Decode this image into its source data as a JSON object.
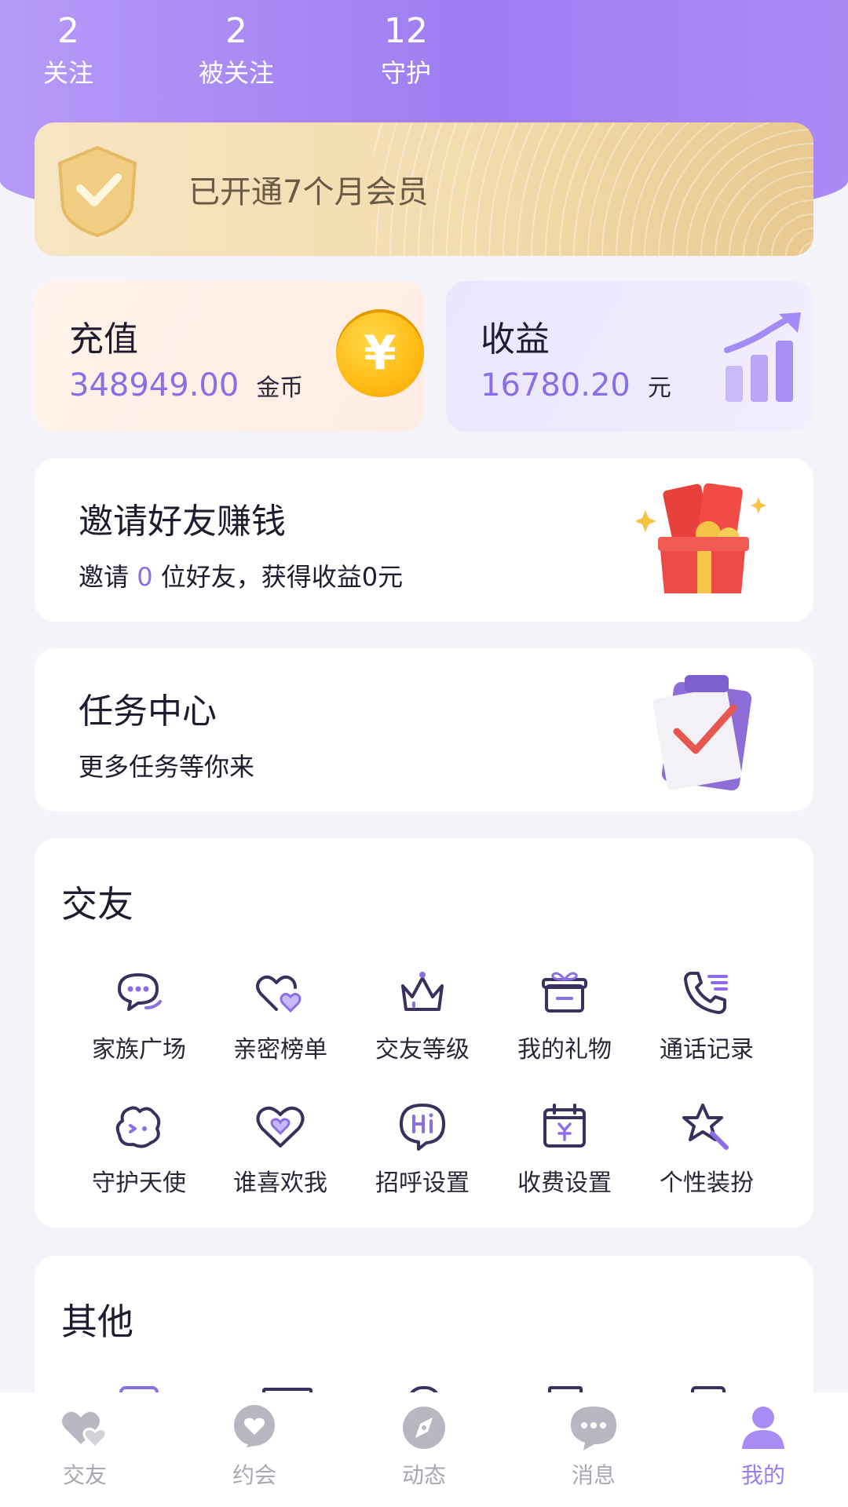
{
  "stats": [
    {
      "value": "2",
      "label": "关注"
    },
    {
      "value": "2",
      "label": "被关注"
    },
    {
      "value": "12",
      "label": "守护"
    }
  ],
  "vip": {
    "text": "已开通7个月会员"
  },
  "recharge": {
    "title": "充值",
    "value": "348949.00",
    "unit": "金币",
    "coin_symbol": "¥"
  },
  "income": {
    "title": "收益",
    "value": "16780.20",
    "unit": "元"
  },
  "invite": {
    "title": "邀请好友赚钱",
    "sub_prefix": "邀请",
    "count": "0",
    "sub_suffix": "位好友，获得收益0元"
  },
  "tasks": {
    "title": "任务中心",
    "subtitle": "更多任务等你来"
  },
  "friends_section": {
    "title": "交友",
    "items": [
      {
        "label": "家族广场",
        "icon": "chat-bubbles-icon"
      },
      {
        "label": "亲密榜单",
        "icon": "hearts-icon"
      },
      {
        "label": "交友等级",
        "icon": "crown-icon"
      },
      {
        "label": "我的礼物",
        "icon": "gift-icon"
      },
      {
        "label": "通话记录",
        "icon": "phone-icon"
      },
      {
        "label": "守护天使",
        "icon": "angel-icon"
      },
      {
        "label": "谁喜欢我",
        "icon": "heart-icon"
      },
      {
        "label": "招呼设置",
        "icon": "hi-bubble-icon"
      },
      {
        "label": "收费设置",
        "icon": "price-calendar-icon"
      },
      {
        "label": "个性装扮",
        "icon": "star-wand-icon"
      }
    ]
  },
  "other_section": {
    "title": "其他"
  },
  "tabbar": {
    "items": [
      {
        "label": "交友",
        "icon": "hearts-tab-icon"
      },
      {
        "label": "约会",
        "icon": "heart-bubble-tab-icon"
      },
      {
        "label": "动态",
        "icon": "compass-tab-icon"
      },
      {
        "label": "消息",
        "icon": "message-tab-icon"
      },
      {
        "label": "我的",
        "icon": "profile-tab-icon"
      }
    ],
    "active_index": 4
  },
  "colors": {
    "accent": "#9a7cf0",
    "header": "#a98af5",
    "gold": "#f3dcae"
  }
}
